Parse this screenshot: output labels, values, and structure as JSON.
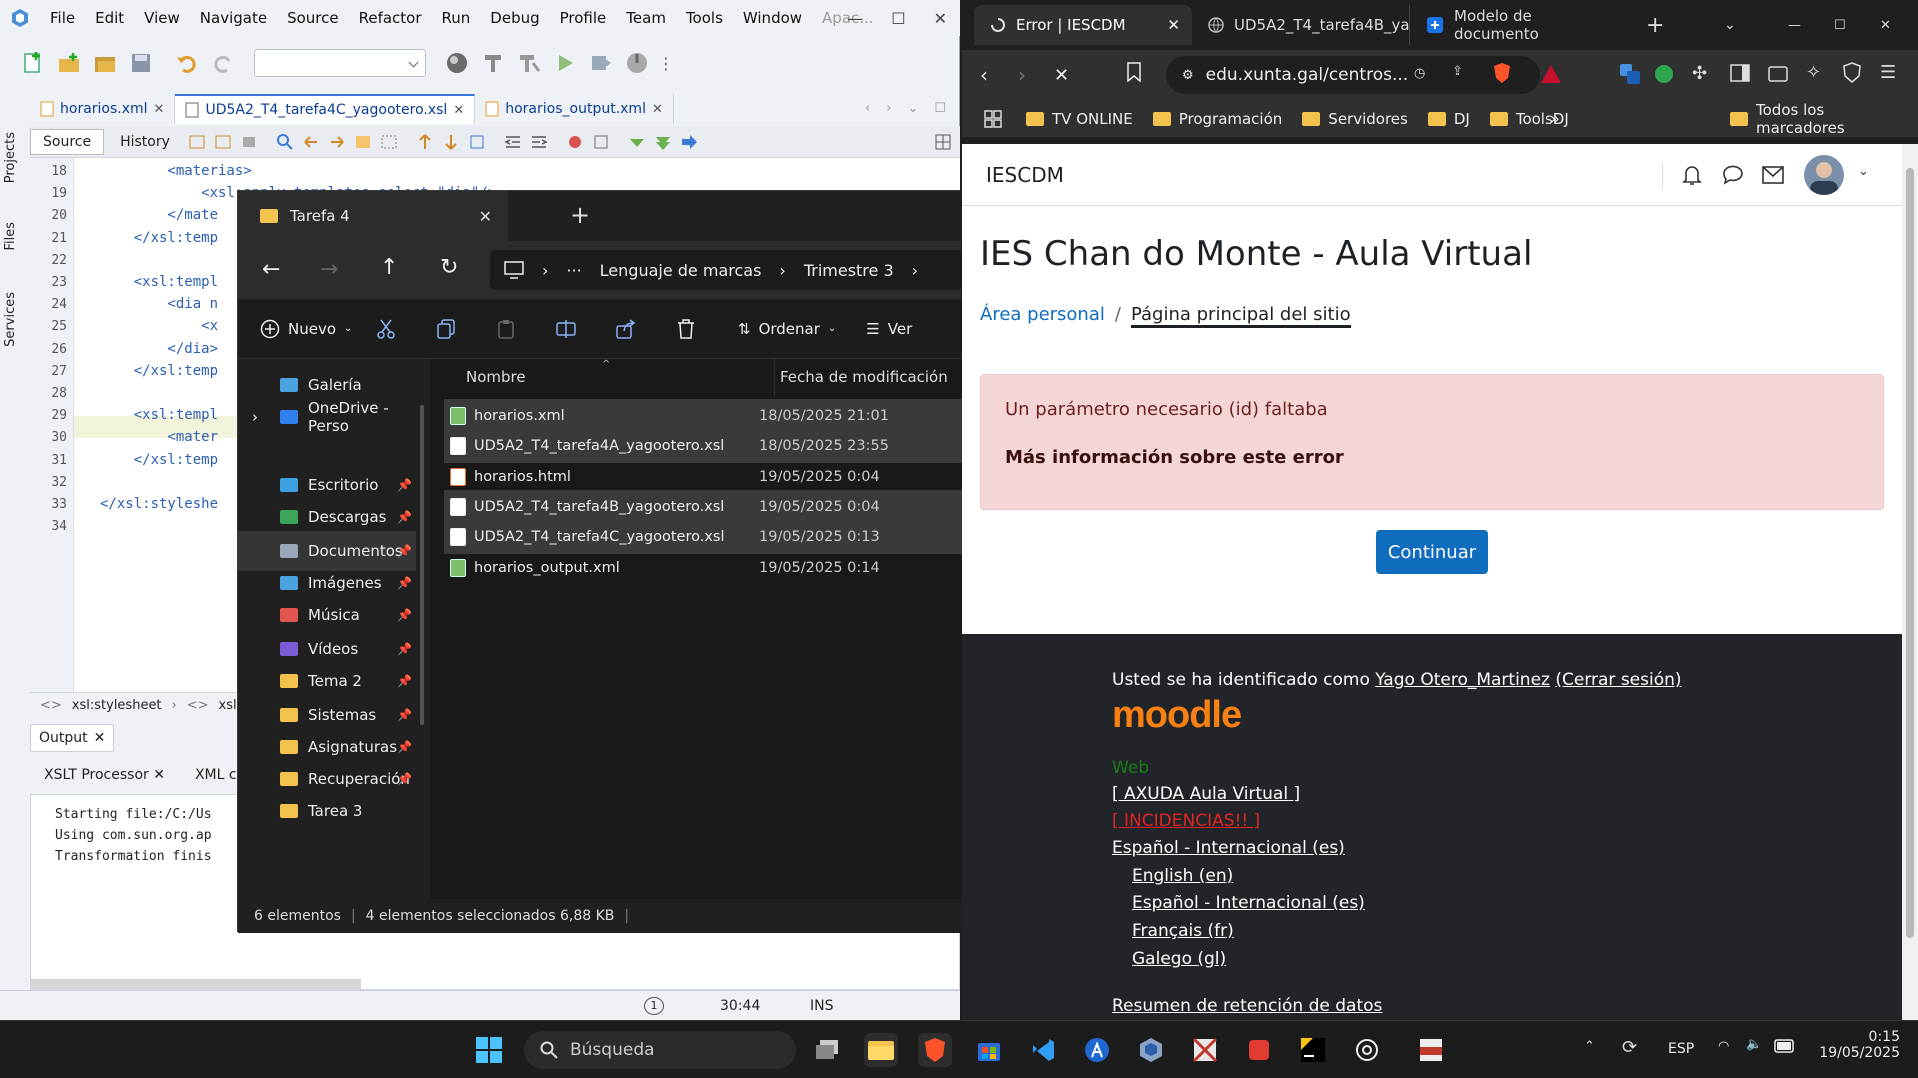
{
  "netbeans": {
    "menu": [
      "File",
      "Edit",
      "View",
      "Navigate",
      "Source",
      "Refactor",
      "Run",
      "Debug",
      "Profile",
      "Team",
      "Tools",
      "Window",
      "Apac..."
    ],
    "side_tabs": [
      "Projects",
      "Files",
      "Services"
    ],
    "file_tabs": [
      {
        "label": "horarios.xml"
      },
      {
        "label": "UD5A2_T4_tarefa4C_yagootero.xsl"
      },
      {
        "label": "horarios_output.xml"
      }
    ],
    "source_tab": "Source",
    "history_tab": "History",
    "line_numbers": [
      "18",
      "19",
      "20",
      "21",
      "22",
      "23",
      "24",
      "25",
      "26",
      "27",
      "28",
      "29",
      "30",
      "31",
      "32",
      "33",
      "34"
    ],
    "code_lines": [
      "        <materias>",
      "            <xsl:apply-templates select=\"dia\"/>",
      "        </mate",
      "    </xsl:temp",
      "",
      "    <xsl:templ",
      "        <dia n",
      "            <x",
      "        </dia>",
      "    </xsl:temp",
      "",
      "    <xsl:templ",
      "        <mater",
      "    </xsl:temp",
      "",
      "</xsl:styleshe",
      ""
    ],
    "breadcrumb": [
      "xsl:stylesheet",
      "xsl:t"
    ],
    "output_tab": "Output",
    "output_subtabs": [
      "XSLT Processor",
      "XML c"
    ],
    "output_lines": [
      "Starting file:/C:/Us",
      "Using com.sun.org.ap",
      "Transformation finis"
    ],
    "status_pos": "30:44",
    "status_mode": "INS",
    "status_badge": "1"
  },
  "explorer": {
    "title": "Tarefa 4",
    "address": [
      "Lenguaje de marcas",
      "Trimestre 3"
    ],
    "address_more": "···",
    "new_label": "Nuevo",
    "sort_label": "Ordenar",
    "view_label": "Ver",
    "sidebar": [
      {
        "label": "Galería",
        "pin": false
      },
      {
        "label": "OneDrive - Perso",
        "pin": false
      },
      {
        "label": "Escritorio",
        "pin": true
      },
      {
        "label": "Descargas",
        "pin": true
      },
      {
        "label": "Documentos",
        "pin": true
      },
      {
        "label": "Imágenes",
        "pin": true
      },
      {
        "label": "Música",
        "pin": true
      },
      {
        "label": "Vídeos",
        "pin": true
      },
      {
        "label": "Tema 2",
        "pin": true
      },
      {
        "label": "Sistemas",
        "pin": true
      },
      {
        "label": "Asignaturas",
        "pin": true
      },
      {
        "label": "Recuperación",
        "pin": true
      },
      {
        "label": "Tarea 3",
        "pin": false
      }
    ],
    "col_name": "Nombre",
    "col_date": "Fecha de modificación",
    "files": [
      {
        "name": "horarios.xml",
        "date": "18/05/2025 21:01",
        "selected": true,
        "kind": "xml"
      },
      {
        "name": "UD5A2_T4_tarefa4A_yagootero.xsl",
        "date": "18/05/2025 23:55",
        "selected": true,
        "kind": "doc"
      },
      {
        "name": "horarios.html",
        "date": "19/05/2025 0:04",
        "selected": false,
        "kind": "html"
      },
      {
        "name": "UD5A2_T4_tarefa4B_yagootero.xsl",
        "date": "19/05/2025 0:04",
        "selected": true,
        "kind": "doc"
      },
      {
        "name": "UD5A2_T4_tarefa4C_yagootero.xsl",
        "date": "19/05/2025 0:13",
        "selected": true,
        "kind": "doc"
      },
      {
        "name": "horarios_output.xml",
        "date": "19/05/2025 0:14",
        "selected": false,
        "kind": "xml"
      }
    ],
    "status_count": "6 elementos",
    "status_selected": "4 elementos seleccionados  6,88 KB"
  },
  "browser": {
    "tabs": [
      {
        "label": "Error | IESCDM"
      },
      {
        "label": "UD5A2_T4_tarefa4B_ya"
      },
      {
        "label": "Modelo de documento"
      }
    ],
    "url": "edu.xunta.gal/centros...",
    "bookmarks": [
      "TV ONLINE",
      "Programación",
      "Servidores",
      "DJ",
      "ToolsDJ"
    ],
    "bookmarks_all": "Todos los marcadores",
    "site_name": "IESCDM",
    "page_title": "IES Chan do Monte - Aula Virtual",
    "crumb_home": "Área personal",
    "crumb_sep": "/",
    "crumb_current": "Página principal del sitio",
    "error_msg": "Un parámetro necesario (id) faltaba",
    "error_more": "Más información sobre este error",
    "continue_btn": "Continuar",
    "footer_logged": "Usted se ha identificado como",
    "footer_user": "Yago Otero_Martinez",
    "footer_logout": "(Cerrar sesión)",
    "footer_logo": "moodle",
    "footer_web": "Web",
    "footer_help": "[ AXUDA Aula Virtual ]",
    "footer_incid": "[ INCIDENCIAS!! ]",
    "footer_lang_current": "Español - Internacional (es)",
    "footer_langs": [
      "English (en)",
      "Español - Internacional (es)",
      "Français (fr)",
      "Galego (gl)"
    ],
    "footer_retention": "Resumen de retención de datos"
  },
  "taskbar": {
    "search": "Búsqueda",
    "lang": "ESP",
    "time": "0:15",
    "date": "19/05/2025"
  }
}
